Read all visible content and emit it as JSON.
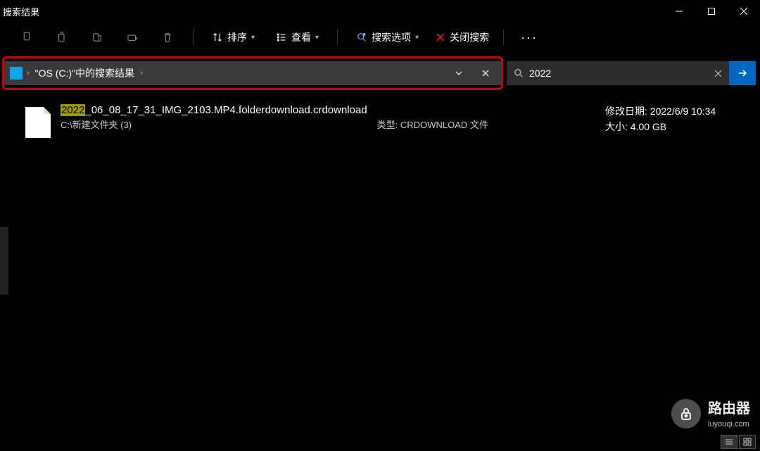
{
  "window": {
    "title": "搜索结果"
  },
  "toolbar": {
    "sort": "排序",
    "view": "查看",
    "searchOptions": "搜索选项",
    "closeSearch": "关闭搜索"
  },
  "address": {
    "crumb1": "\"OS (C:)\"中的搜索结果"
  },
  "search": {
    "query": "2022"
  },
  "result": {
    "highlight": "2022",
    "nameRest": "_06_08_17_31_IMG_2103.MP4.folderdownload.crdownload",
    "path": "C:\\新建文件夹 (3)",
    "typeLabel": "类型:",
    "typeValue": "CRDOWNLOAD 文件",
    "modifiedLabel": "修改日期:",
    "modifiedValue": "2022/6/9 10:34",
    "sizeLabel": "大小:",
    "sizeValue": "4.00 GB"
  },
  "watermark": {
    "title": "路由器",
    "sub": "luyouqi.com"
  }
}
